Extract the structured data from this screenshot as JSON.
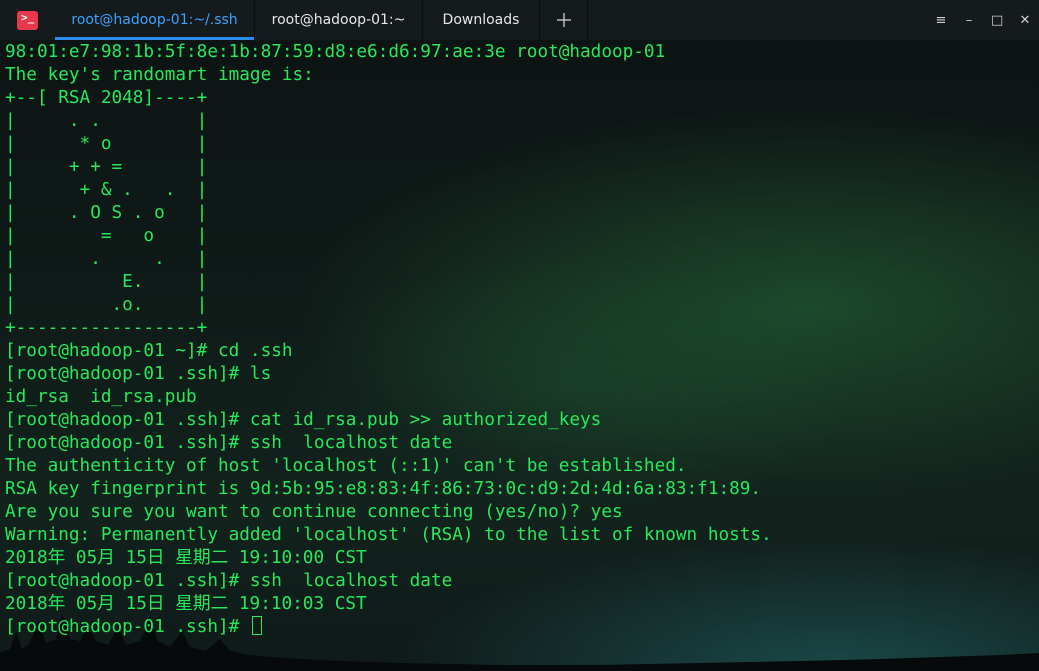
{
  "tabs": [
    {
      "label": "root@hadoop-01:~/.ssh",
      "active": true
    },
    {
      "label": "root@hadoop-01:~",
      "active": false
    },
    {
      "label": "Downloads",
      "active": false
    }
  ],
  "add_tab_icon": "plus-icon",
  "window_controls": {
    "menu": "≡",
    "minimize": "–",
    "maximize": "□",
    "close": "✕"
  },
  "colors": {
    "terminal_text": "#27e85a",
    "active_tab": "#3aa3ff",
    "app_icon": "#e8394c"
  },
  "terminal": {
    "lines": [
      "98:01:e7:98:1b:5f:8e:1b:87:59:d8:e6:d6:97:ae:3e root@hadoop-01",
      "The key's randomart image is:",
      "+--[ RSA 2048]----+",
      "|     . .         |",
      "|      * o        |",
      "|     + + =       |",
      "|      + & .   .  |",
      "|     . O S . o   |",
      "|        =   o    |",
      "|       .     .   |",
      "|          E.     |",
      "|         .o.     |",
      "+-----------------+",
      "[root@hadoop-01 ~]# cd .ssh",
      "[root@hadoop-01 .ssh]# ls",
      "id_rsa  id_rsa.pub",
      "[root@hadoop-01 .ssh]# cat id_rsa.pub >> authorized_keys",
      "[root@hadoop-01 .ssh]# ssh  localhost date",
      "The authenticity of host 'localhost (::1)' can't be established.",
      "RSA key fingerprint is 9d:5b:95:e8:83:4f:86:73:0c:d9:2d:4d:6a:83:f1:89.",
      "Are you sure you want to continue connecting (yes/no)? yes",
      "Warning: Permanently added 'localhost' (RSA) to the list of known hosts.",
      "2018年 05月 15日 星期二 19:10:00 CST",
      "[root@hadoop-01 .ssh]# ssh  localhost date",
      "2018年 05月 15日 星期二 19:10:03 CST"
    ],
    "prompt": "[root@hadoop-01 .ssh]# "
  }
}
